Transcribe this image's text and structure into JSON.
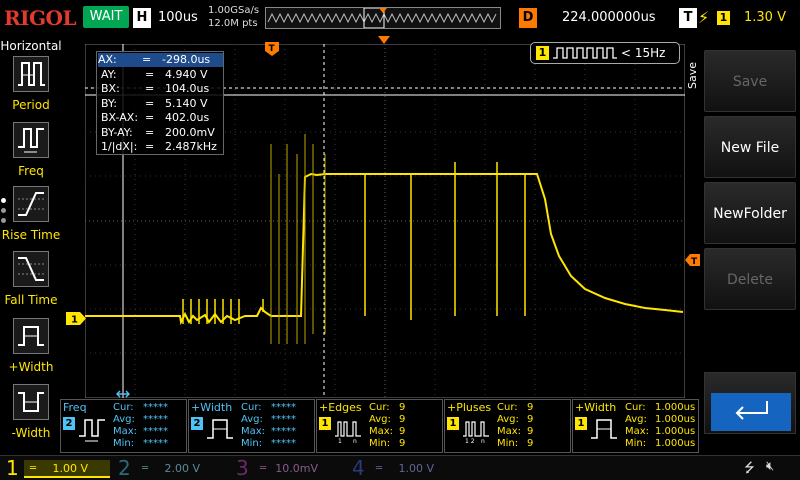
{
  "topbar": {
    "brand": "RIGOL",
    "run_state": "WAIT",
    "h_label": "H",
    "timebase": "100us",
    "sample_rate": "1.00GSa/s",
    "memory_depth": "12.0M pts",
    "d_label": "D",
    "delay": "224.000000us",
    "t_label": "T",
    "trigger_channel": "1",
    "trigger_level": "1.30 V",
    "colors": {
      "brand": "#e23b2e",
      "run": "#00a651",
      "delay": "#ff7a00",
      "ch1": "#ffe600"
    }
  },
  "left_menu": {
    "title": "Horizontal",
    "items": [
      {
        "label": "Period",
        "icon": "period-icon"
      },
      {
        "label": "Freq",
        "icon": "freq-icon"
      },
      {
        "label": "Rise Time",
        "icon": "rise-time-icon"
      },
      {
        "label": "Fall Time",
        "icon": "fall-time-icon"
      },
      {
        "label": "+Width",
        "icon": "positive-width-icon"
      },
      {
        "label": "-Width",
        "icon": "negative-width-icon"
      }
    ]
  },
  "cursor": {
    "rows": [
      {
        "k": "AX:",
        "v": "-298.0us",
        "highlight": true
      },
      {
        "k": "AY:",
        "v": "4.940 V"
      },
      {
        "k": "BX:",
        "v": "104.0us"
      },
      {
        "k": "BY:",
        "v": "5.140 V"
      },
      {
        "k": "BX-AX:",
        "v": "402.0us"
      },
      {
        "k": "BY-AY:",
        "v": "200.0mV"
      },
      {
        "k": "1/|dX|:",
        "v": "2.487kHz"
      }
    ],
    "eq": "="
  },
  "trigger_readout": {
    "channel": "1",
    "condition": "< 15Hz"
  },
  "markers": {
    "ch1": "1",
    "trigger_top": "T"
  },
  "right_menu": {
    "title": "Save",
    "buttons": [
      {
        "label": "Save",
        "enabled": false
      },
      {
        "label": "New File",
        "enabled": true
      },
      {
        "label": "NewFolder",
        "enabled": true
      },
      {
        "label": "Delete",
        "enabled": false
      }
    ],
    "back_icon": "return-arrow-icon"
  },
  "measurements": [
    {
      "title": "Freq",
      "channel": "2",
      "color": "blue",
      "stats": [
        [
          "Cur:",
          "*****"
        ],
        [
          "Avg:",
          "*****"
        ],
        [
          "Max:",
          "*****"
        ],
        [
          "Min:",
          "*****"
        ]
      ]
    },
    {
      "title": "+Width",
      "channel": "2",
      "color": "blue",
      "stats": [
        [
          "Cur:",
          "*****"
        ],
        [
          "Avg:",
          "*****"
        ],
        [
          "Max:",
          "*****"
        ],
        [
          "Min:",
          "*****"
        ]
      ]
    },
    {
      "title": "+Edges",
      "channel": "1",
      "color": "yellow",
      "stats": [
        [
          "Cur:",
          "9"
        ],
        [
          "Avg:",
          "9"
        ],
        [
          "Max:",
          "9"
        ],
        [
          "Min:",
          "9"
        ]
      ]
    },
    {
      "title": "+Pluses",
      "channel": "1",
      "color": "yellow",
      "stats": [
        [
          "Cur:",
          "9"
        ],
        [
          "Avg:",
          "9"
        ],
        [
          "Max:",
          "9"
        ],
        [
          "Min:",
          "9"
        ]
      ]
    },
    {
      "title": "+Width",
      "channel": "1",
      "color": "yellow",
      "stats": [
        [
          "Cur:",
          "1.000us"
        ],
        [
          "Avg:",
          "1.000us"
        ],
        [
          "Max:",
          "1.000us"
        ],
        [
          "Min:",
          "1.000us"
        ]
      ]
    }
  ],
  "channels": [
    {
      "num": "1",
      "value": "1.00 V",
      "color": "#ffe600",
      "active": true
    },
    {
      "num": "2",
      "value": "2.00 V",
      "color": "#3fb4d8",
      "active": false
    },
    {
      "num": "3",
      "value": "10.0mV",
      "color": "#c040c0",
      "active": false
    },
    {
      "num": "4",
      "value": "1.00 V",
      "color": "#3060ff",
      "active": false
    }
  ],
  "status_icons": [
    "usb-icon",
    "mute-icon"
  ]
}
